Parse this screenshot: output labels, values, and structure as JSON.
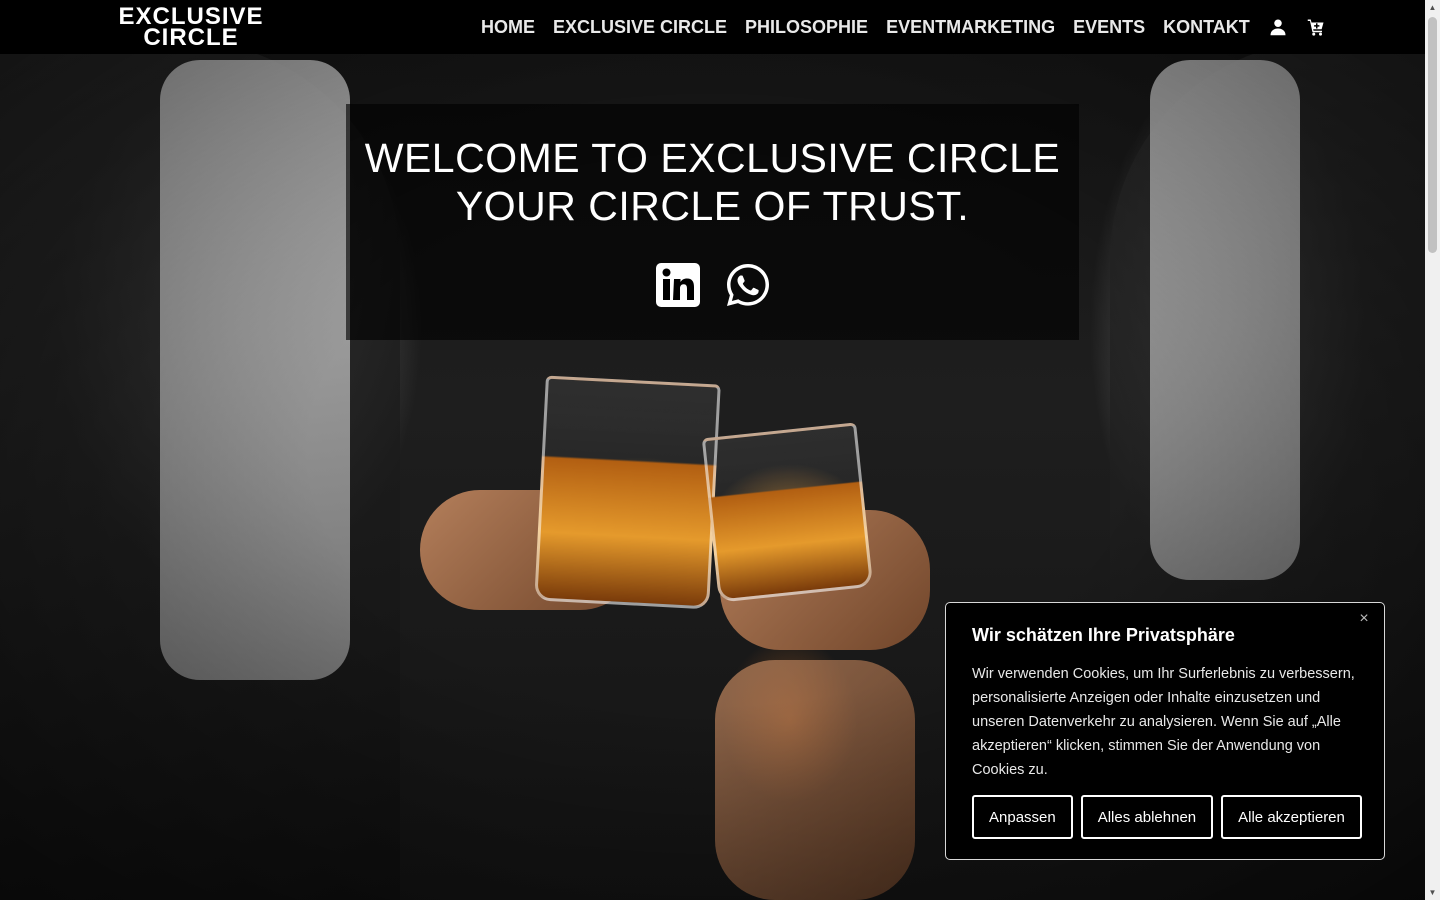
{
  "logo": {
    "line1": "EXCLUSIVE",
    "line2": "CIRCLE"
  },
  "nav": {
    "items": [
      {
        "label": "HOME"
      },
      {
        "label": "EXCLUSIVE CIRCLE"
      },
      {
        "label": "PHILOSOPHIE"
      },
      {
        "label": "EVENTMARKETING"
      },
      {
        "label": "EVENTS"
      },
      {
        "label": "KONTAKT"
      }
    ],
    "icons": [
      "user-icon",
      "cart-icon"
    ]
  },
  "hero": {
    "title_line1": "WELCOME TO EXCLUSIVE CIRCLE",
    "title_line2": "YOUR CIRCLE OF TRUST.",
    "social_icons": [
      "linkedin-icon",
      "whatsapp-icon"
    ]
  },
  "cookie": {
    "title": "Wir schätzen Ihre Privatsphäre",
    "text": "Wir verwenden Cookies, um Ihr Surferlebnis zu verbessern, personalisierte Anzeigen oder Inhalte einzusetzen und unseren Datenverkehr zu analysieren. Wenn Sie auf „Alle akzeptieren“ klicken, stimmen Sie der Anwendung von Cookies zu.",
    "close_icon": "close-icon",
    "buttons": {
      "customize": "Anpassen",
      "reject": "Alles ablehnen",
      "accept": "Alle akzeptieren"
    }
  },
  "colors": {
    "header_bg": "#000000",
    "text": "#ffffff",
    "dialog_bg": "#000000",
    "dialog_border": "#d8d8d8"
  }
}
